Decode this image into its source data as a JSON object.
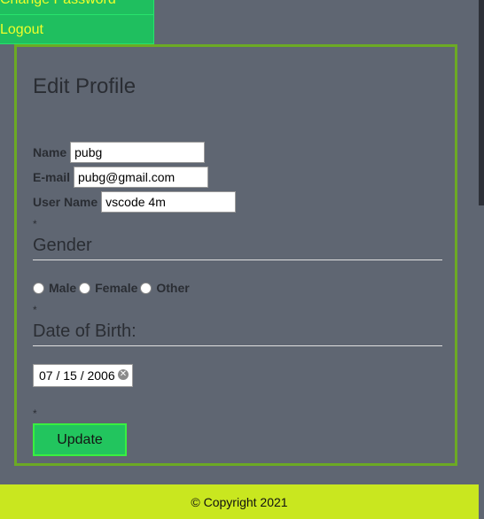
{
  "menu": {
    "change_password": "Change Password",
    "logout": "Logout"
  },
  "profile": {
    "title": "Edit Profile",
    "name": {
      "label": "Name",
      "value": "pubg"
    },
    "email": {
      "label": "E-mail",
      "value": "pubg@gmail.com"
    },
    "username": {
      "label": "User Name",
      "value": "vscode 4m"
    },
    "gender": {
      "asterisk": "*",
      "heading": "Gender",
      "options": [
        "Male",
        "Female",
        "Other"
      ]
    },
    "dob": {
      "asterisk": "*",
      "heading": "Date of Birth:",
      "value": "07 / 15 / 2006"
    },
    "update_asterisk": "*",
    "update_label": "Update"
  },
  "footer": {
    "text": "© Copyright 2021"
  },
  "colors": {
    "background": "#5f6672",
    "menu_green": "#1fbf5f",
    "menu_text": "#f0ff2a",
    "border_green": "#6caa24",
    "footer": "#c9e71f"
  },
  "icons": {
    "date_clear": "clear-icon"
  }
}
